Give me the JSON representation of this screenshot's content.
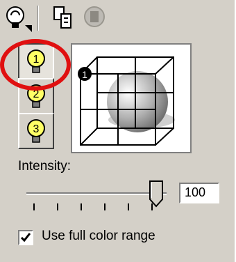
{
  "toolbar": {
    "items": [
      "light-tool-icon",
      "copy-light-icon",
      "disabled-sphere-icon"
    ]
  },
  "lights": [
    {
      "label": "1",
      "active": true
    },
    {
      "label": "2",
      "active": false
    },
    {
      "label": "3",
      "active": false
    }
  ],
  "preview": {
    "badge": "1"
  },
  "intensity": {
    "label": "Intensity:",
    "value": "100",
    "level_fraction": 1.0
  },
  "full_range": {
    "label": "Use full color range",
    "checked": true
  },
  "colors": {
    "panel": "#d4d0c8",
    "highlight_ring": "#e01010"
  }
}
